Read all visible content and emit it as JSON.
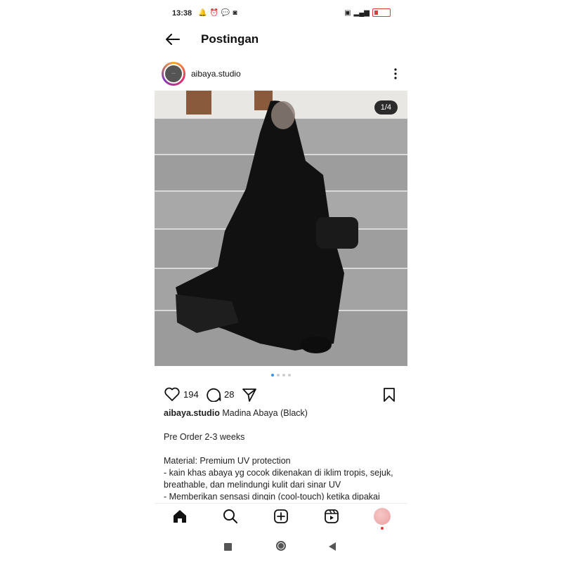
{
  "status_bar": {
    "time": "13:38",
    "left_icons": [
      "alarm-icon",
      "clock-icon",
      "chat-icon",
      "instagram-icon"
    ],
    "right_icons": [
      "nfc-icon",
      "signal-icon",
      "battery-icon"
    ]
  },
  "top_bar": {
    "title": "Postingan"
  },
  "post": {
    "username": "aibaya.studio",
    "counter": "1/4",
    "likes": "194",
    "comments": "28",
    "caption": {
      "username": "aibaya.studio",
      "title": "Madina Abaya (Black)",
      "line2": "Pre Order 2-3 weeks",
      "line3": "Material: Premium UV protection",
      "line4": "- kain khas abaya yg cocok dikenakan di iklim tropis, sejuk, breathable, dan melindungi kulit dari sinar UV",
      "line5": "- Memberikan sensasi dingin (cool-touch) ketika dipakai"
    },
    "carousel": {
      "current": 1,
      "total": 4
    }
  },
  "colors": {
    "accent_dot": "#3897f0",
    "text": "#111111",
    "battery": "#e03a3a"
  }
}
